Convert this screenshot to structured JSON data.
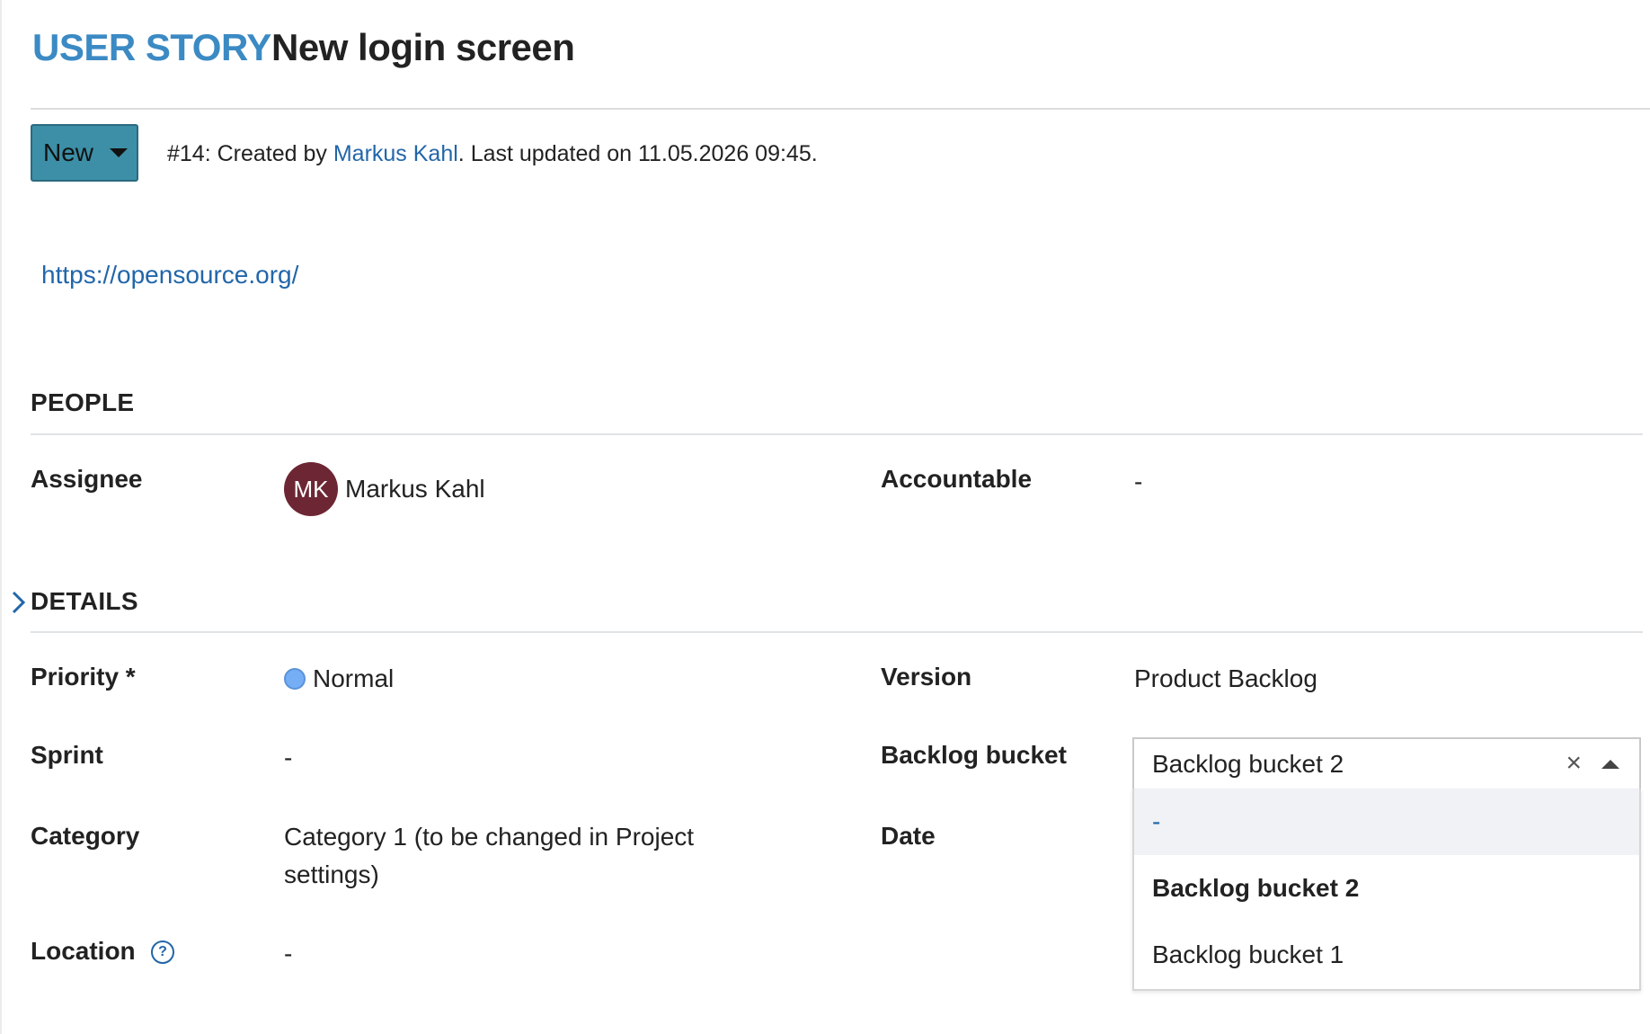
{
  "header": {
    "type_label": "USER STORY",
    "subject": "New login screen"
  },
  "status": {
    "label": "New",
    "color": "#3c8fa6"
  },
  "meta": {
    "prefix": "#14: Created by ",
    "author": "Markus Kahl",
    "suffix": ". Last updated on 11.05.2026 09:45."
  },
  "description": {
    "link": "https://opensource.org/"
  },
  "sections": {
    "people": "PEOPLE",
    "details": "DETAILS"
  },
  "people": {
    "assignee_label": "Assignee",
    "assignee_initials": "MK",
    "assignee_name": "Markus Kahl",
    "accountable_label": "Accountable",
    "accountable_value": "-"
  },
  "details": {
    "priority_label": "Priority *",
    "priority_value": "Normal",
    "version_label": "Version",
    "version_value": "Product Backlog",
    "sprint_label": "Sprint",
    "sprint_value": "-",
    "backlog_label": "Backlog bucket",
    "category_label": "Category",
    "category_value_line1": "Category 1 (to be changed in Project",
    "category_value_line2": "settings)",
    "date_label": "Date",
    "location_label": "Location",
    "location_value": "-"
  },
  "backlog_select": {
    "selected": "Backlog bucket 2",
    "options": [
      "-",
      "Backlog bucket 2",
      "Backlog bucket 1"
    ]
  },
  "icons": {
    "help": "?",
    "clear": "×"
  }
}
